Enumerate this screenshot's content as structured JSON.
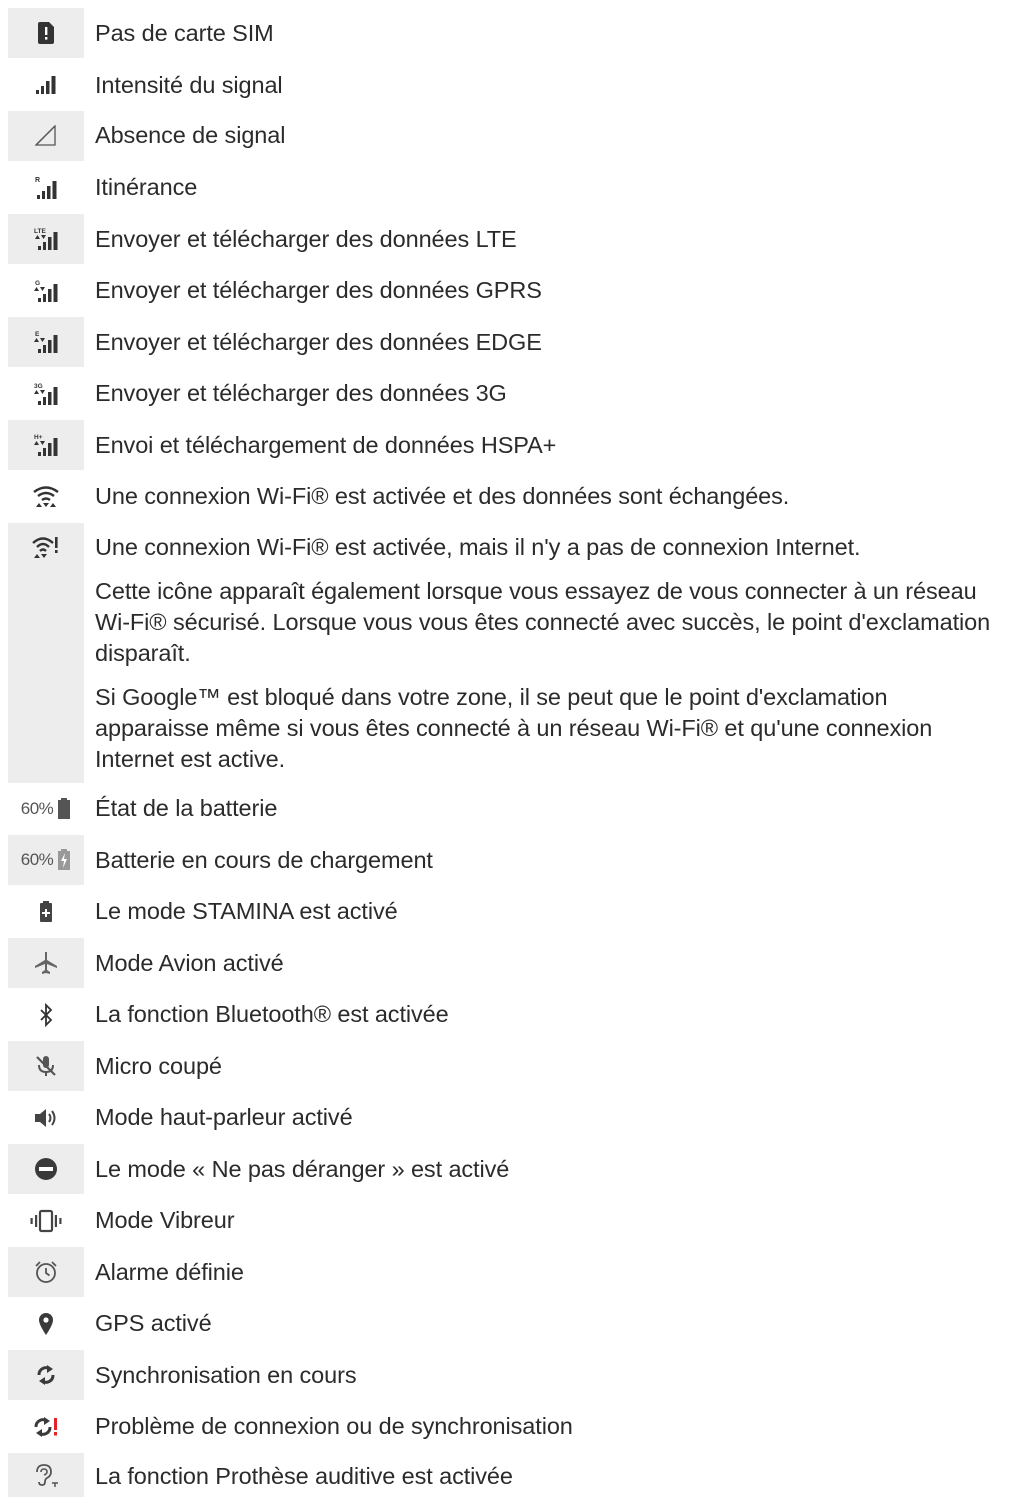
{
  "rows": [
    {
      "icon": "no-sim-icon",
      "text": "Pas de carte SIM"
    },
    {
      "icon": "signal-strength-icon",
      "text": "Intensité du signal"
    },
    {
      "icon": "no-signal-icon",
      "text": "Absence de signal"
    },
    {
      "icon": "roaming-icon",
      "text": "Itinérance",
      "icon_badge": "R"
    },
    {
      "icon": "lte-data-icon",
      "text": "Envoyer et télécharger des données LTE",
      "icon_badge": "LTE"
    },
    {
      "icon": "gprs-data-icon",
      "text": "Envoyer et télécharger des données GPRS",
      "icon_badge": "G"
    },
    {
      "icon": "edge-data-icon",
      "text": "Envoyer et télécharger des données EDGE",
      "icon_badge": "E"
    },
    {
      "icon": "3g-data-icon",
      "text": "Envoyer et télécharger des données 3G",
      "icon_badge": "3G"
    },
    {
      "icon": "hspa-data-icon",
      "text": "Envoi et téléchargement de données HSPA+",
      "icon_badge": "H+"
    },
    {
      "icon": "wifi-active-icon",
      "text": "Une connexion Wi-Fi® est activée et des données sont échangées."
    },
    {
      "icon": "wifi-no-internet-icon",
      "text": "Une connexion Wi-Fi® est activée, mais il n'y a pas de connexion Internet.",
      "extra": [
        "Cette icône apparaît également lorsque vous essayez de vous connecter à un réseau Wi-Fi® sécurisé. Lorsque vous vous êtes connecté avec succès, le point d'exclamation disparaît.",
        "Si Google™ est bloqué dans votre zone, il se peut que le point d'exclamation apparaisse même si vous êtes connecté à un réseau Wi-Fi® et qu'une connexion Internet est active."
      ]
    },
    {
      "icon": "battery-status-icon",
      "text": "État de la batterie",
      "icon_label": "60%"
    },
    {
      "icon": "battery-charging-icon",
      "text": "Batterie en cours de chargement",
      "icon_label": "60%"
    },
    {
      "icon": "stamina-icon",
      "text": "Le mode STAMINA est activé"
    },
    {
      "icon": "airplane-icon",
      "text": "Mode Avion activé"
    },
    {
      "icon": "bluetooth-icon",
      "text": "La fonction Bluetooth® est activée"
    },
    {
      "icon": "mic-muted-icon",
      "text": "Micro coupé"
    },
    {
      "icon": "speaker-icon",
      "text": "Mode haut-parleur activé"
    },
    {
      "icon": "do-not-disturb-icon",
      "text": "Le mode « Ne pas déranger » est activé"
    },
    {
      "icon": "vibrate-icon",
      "text": "Mode Vibreur"
    },
    {
      "icon": "alarm-icon",
      "text": "Alarme définie"
    },
    {
      "icon": "gps-icon",
      "text": "GPS activé"
    },
    {
      "icon": "sync-icon",
      "text": "Synchronisation en cours"
    },
    {
      "icon": "sync-problem-icon",
      "text": "Problème de connexion ou de synchronisation"
    },
    {
      "icon": "hearing-aid-icon",
      "text": "La fonction Prothèse auditive est activée"
    }
  ],
  "colors": {
    "cell": "#ededed",
    "icon": "#333333",
    "alert": "#e0242a",
    "text": "#2b2b2b"
  }
}
